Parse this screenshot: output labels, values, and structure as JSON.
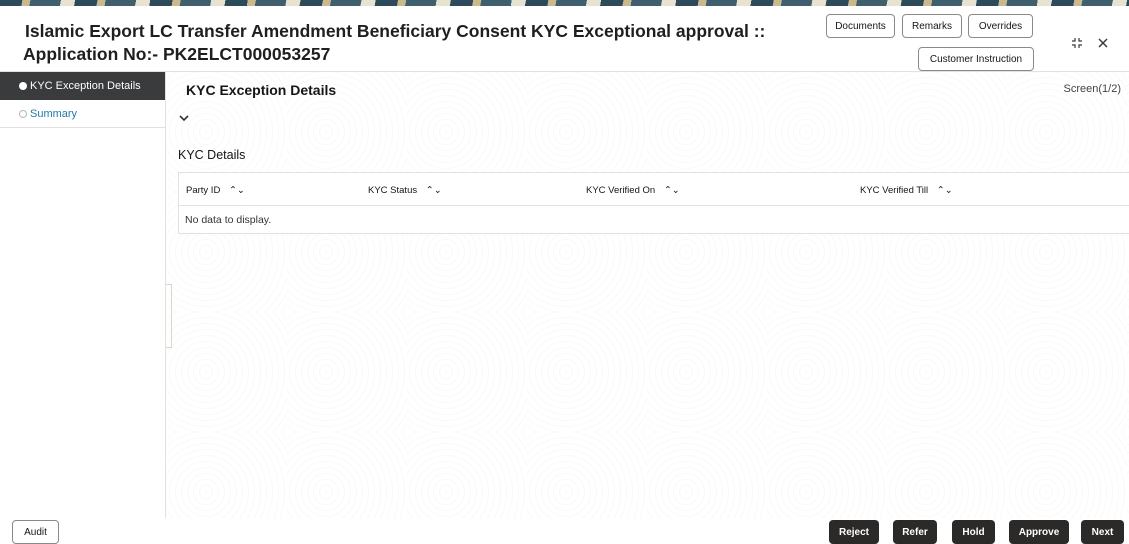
{
  "header": {
    "title_line1": "Islamic Export LC Transfer Amendment Beneficiary Consent KYC Exceptional approval ::",
    "title_line2": "Application No:- PK2ELCT000053257",
    "buttons": {
      "documents": "Documents",
      "remarks": "Remarks",
      "overrides": "Overrides",
      "customer_instruction": "Customer Instruction"
    },
    "icons": {
      "expand": "expand-icon",
      "close": "close-icon"
    }
  },
  "sidebar": {
    "items": [
      {
        "label": "KYC Exception Details",
        "active": true
      },
      {
        "label": "Summary",
        "active": false
      }
    ]
  },
  "main": {
    "section_title": "KYC Exception Details",
    "screen_indicator": "Screen(1/2)",
    "subsection_title": "KYC Details",
    "table": {
      "columns": [
        "Party ID",
        "KYC Status",
        "KYC Verified On",
        "KYC Verified Till"
      ],
      "empty_message": "No data to display."
    }
  },
  "footer": {
    "audit": "Audit",
    "reject": "Reject",
    "refer": "Refer",
    "hold": "Hold",
    "approve": "Approve",
    "next": "Next"
  },
  "colors": {
    "active_sidebar_bg": "#3a3b3c",
    "link_blue": "#227aa8",
    "primary_button": "#2b2a28"
  }
}
